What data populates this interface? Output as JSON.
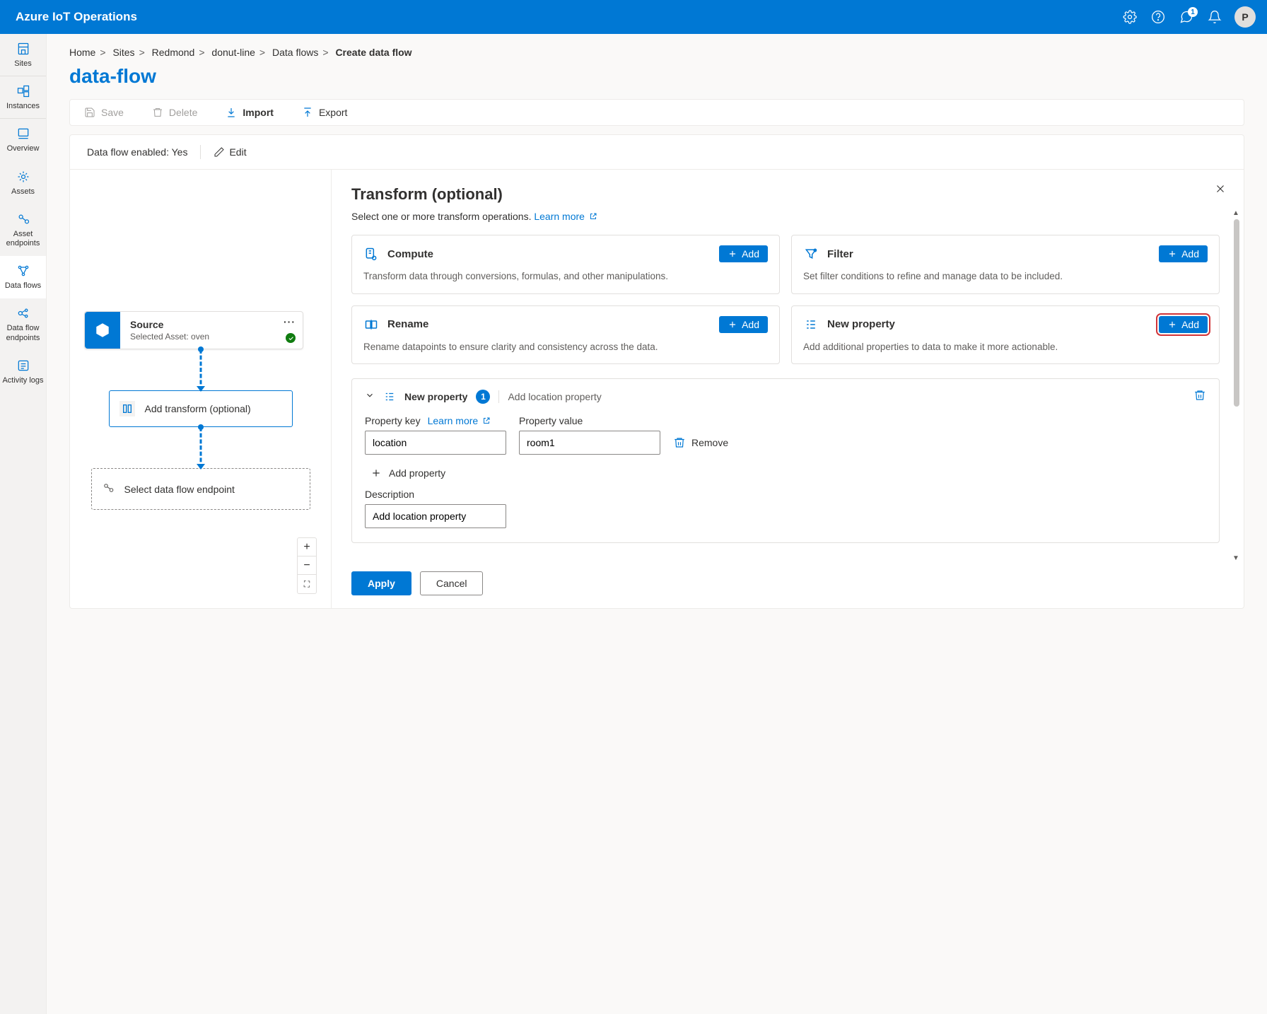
{
  "brand": "Azure IoT Operations",
  "notification_count": "1",
  "avatar_initial": "P",
  "sidebar": {
    "items": [
      {
        "label": "Sites"
      },
      {
        "label": "Instances"
      },
      {
        "label": "Overview"
      },
      {
        "label": "Assets"
      },
      {
        "label": "Asset endpoints"
      },
      {
        "label": "Data flows"
      },
      {
        "label": "Data flow endpoints"
      },
      {
        "label": "Activity logs"
      }
    ]
  },
  "breadcrumb": {
    "items": [
      "Home",
      "Sites",
      "Redmond",
      "donut-line",
      "Data flows"
    ],
    "current": "Create data flow"
  },
  "page_title": "data-flow",
  "toolbar": {
    "save": "Save",
    "delete": "Delete",
    "import": "Import",
    "export": "Export"
  },
  "df": {
    "enabled_label": "Data flow enabled:",
    "enabled_value": "Yes",
    "edit": "Edit",
    "source_title": "Source",
    "source_sub": "Selected Asset: oven",
    "transform_label": "Add transform (optional)",
    "endpoint_label": "Select data flow endpoint"
  },
  "panel": {
    "title": "Transform (optional)",
    "subtitle_pre": "Select one or more transform operations. ",
    "learn_more": "Learn more",
    "ops": {
      "compute": {
        "title": "Compute",
        "desc": "Transform data through conversions, formulas, and other manipulations.",
        "add": "Add"
      },
      "filter": {
        "title": "Filter",
        "desc": "Set filter conditions to refine and manage data to be included.",
        "add": "Add"
      },
      "rename": {
        "title": "Rename",
        "desc": "Rename datapoints to ensure clarity and consistency across the data.",
        "add": "Add"
      },
      "newprop": {
        "title": "New property",
        "desc": "Add additional properties to data to make it more actionable.",
        "add": "Add"
      }
    },
    "section": {
      "title": "New property",
      "count": "1",
      "desc": "Add location property",
      "prop_key_label": "Property key",
      "learn_more": "Learn more",
      "prop_val_label": "Property value",
      "key_value": "location",
      "val_value": "room1",
      "remove": "Remove",
      "add_property": "Add property",
      "description_label": "Description",
      "description_value": "Add location property"
    },
    "apply": "Apply",
    "cancel": "Cancel"
  }
}
